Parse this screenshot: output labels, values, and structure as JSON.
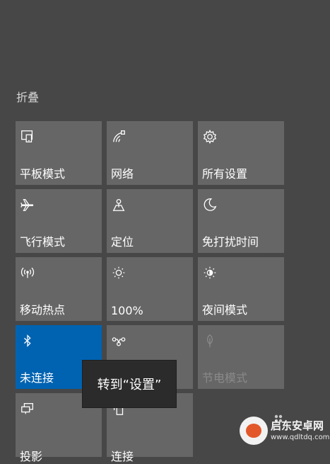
{
  "header": {
    "collapse_label": "折叠"
  },
  "tiles": [
    {
      "label": "平板模式",
      "icon": "tablet-mode-icon"
    },
    {
      "label": "网络",
      "icon": "network-icon"
    },
    {
      "label": "所有设置",
      "icon": "gear-icon"
    },
    {
      "label": "飞行模式",
      "icon": "airplane-icon"
    },
    {
      "label": "定位",
      "icon": "location-icon"
    },
    {
      "label": "免打扰时间",
      "icon": "moon-icon"
    },
    {
      "label": "移动热点",
      "icon": "hotspot-icon"
    },
    {
      "label": "100%",
      "icon": "brightness-icon"
    },
    {
      "label": "夜间模式",
      "icon": "night-light-icon"
    },
    {
      "label": "未连接",
      "icon": "bluetooth-icon",
      "state": "active"
    },
    {
      "label": "",
      "icon": "vpn-icon"
    },
    {
      "label": "节电模式",
      "icon": "battery-saver-icon",
      "state": "disabled"
    },
    {
      "label": "投影",
      "icon": "project-icon"
    },
    {
      "label": "连接",
      "icon": "connect-icon"
    }
  ],
  "tooltip": {
    "text": "转到“设置”"
  },
  "watermark": {
    "line1": "启东安卓网",
    "line2": "www.qdltdq.com"
  },
  "colors": {
    "background": "#474747",
    "tile": "#666666",
    "active_tile": "#0063b1",
    "tooltip": "#2b2b2b"
  }
}
